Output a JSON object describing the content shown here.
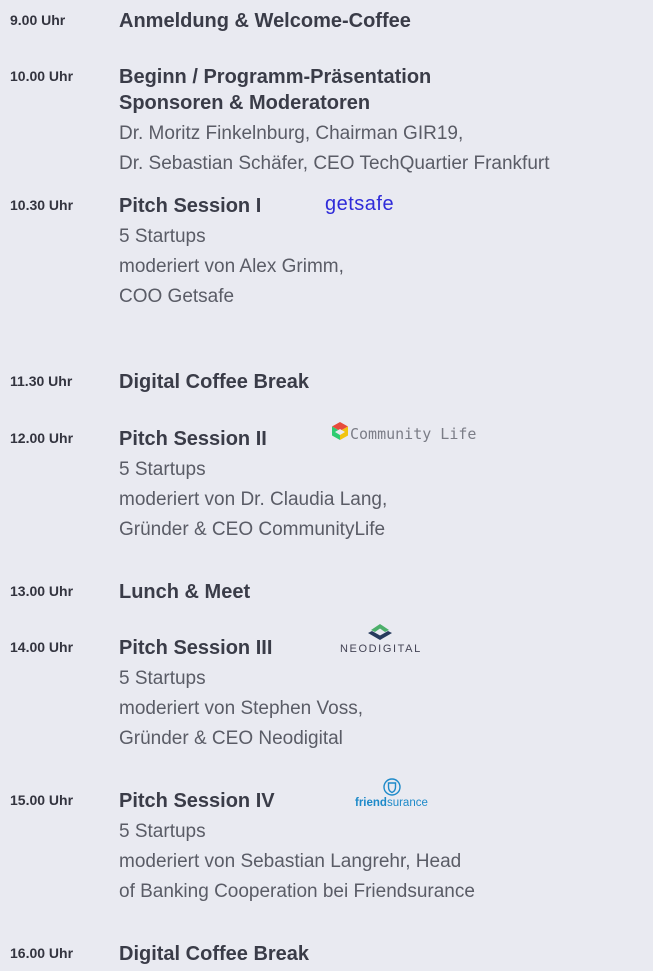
{
  "agenda": [
    {
      "time": "9.00 Uhr",
      "title": "Anmeldung & Welcome-Coffee"
    },
    {
      "time": "10.00 Uhr",
      "title": "Beginn / Programm-Präsentation",
      "title2": "Sponsoren & Moderatoren",
      "lines": [
        "Dr. Moritz Finkelnburg, Chairman GIR19,",
        "Dr. Sebastian Schäfer, CEO TechQuartier Frankfurt"
      ]
    },
    {
      "time": "10.30 Uhr",
      "title": "Pitch Session I",
      "logo": "getsafe",
      "lines": [
        "5 Startups",
        "moderiert von Alex Grimm,",
        "COO Getsafe"
      ]
    },
    {
      "time": "11.30 Uhr",
      "title": "Digital Coffee Break"
    },
    {
      "time": "12.00 Uhr",
      "title": "Pitch Session II",
      "logo": "Community Life",
      "lines": [
        "5 Startups",
        "moderiert von Dr. Claudia Lang,",
        "Gründer & CEO CommunityLife"
      ]
    },
    {
      "time": "13.00 Uhr",
      "title": "Lunch & Meet"
    },
    {
      "time": "14.00 Uhr",
      "title": "Pitch Session III",
      "logo": "NEODIGITAL",
      "lines": [
        "5 Startups",
        "moderiert von Stephen Voss,",
        "Gründer & CEO Neodigital"
      ]
    },
    {
      "time": "15.00 Uhr",
      "title": "Pitch Session IV",
      "logo_bold": "friend",
      "logo_rest": "surance",
      "lines": [
        "5 Startups",
        "moderiert von Sebastian Langrehr, Head",
        "of Banking Cooperation bei Friendsurance"
      ]
    },
    {
      "time": "16.00 Uhr",
      "title": "Digital Coffee Break"
    }
  ],
  "colors": {
    "background": "#e9eaf1",
    "getsafe": "#2f2bd9",
    "friendsurance": "#1e8ac9",
    "neodigital_green": "#4caf6a",
    "neodigital_navy": "#263a5c"
  },
  "icons": [
    "community-life-logo-icon",
    "neodigital-logo-icon",
    "friendsurance-logo-icon"
  ]
}
